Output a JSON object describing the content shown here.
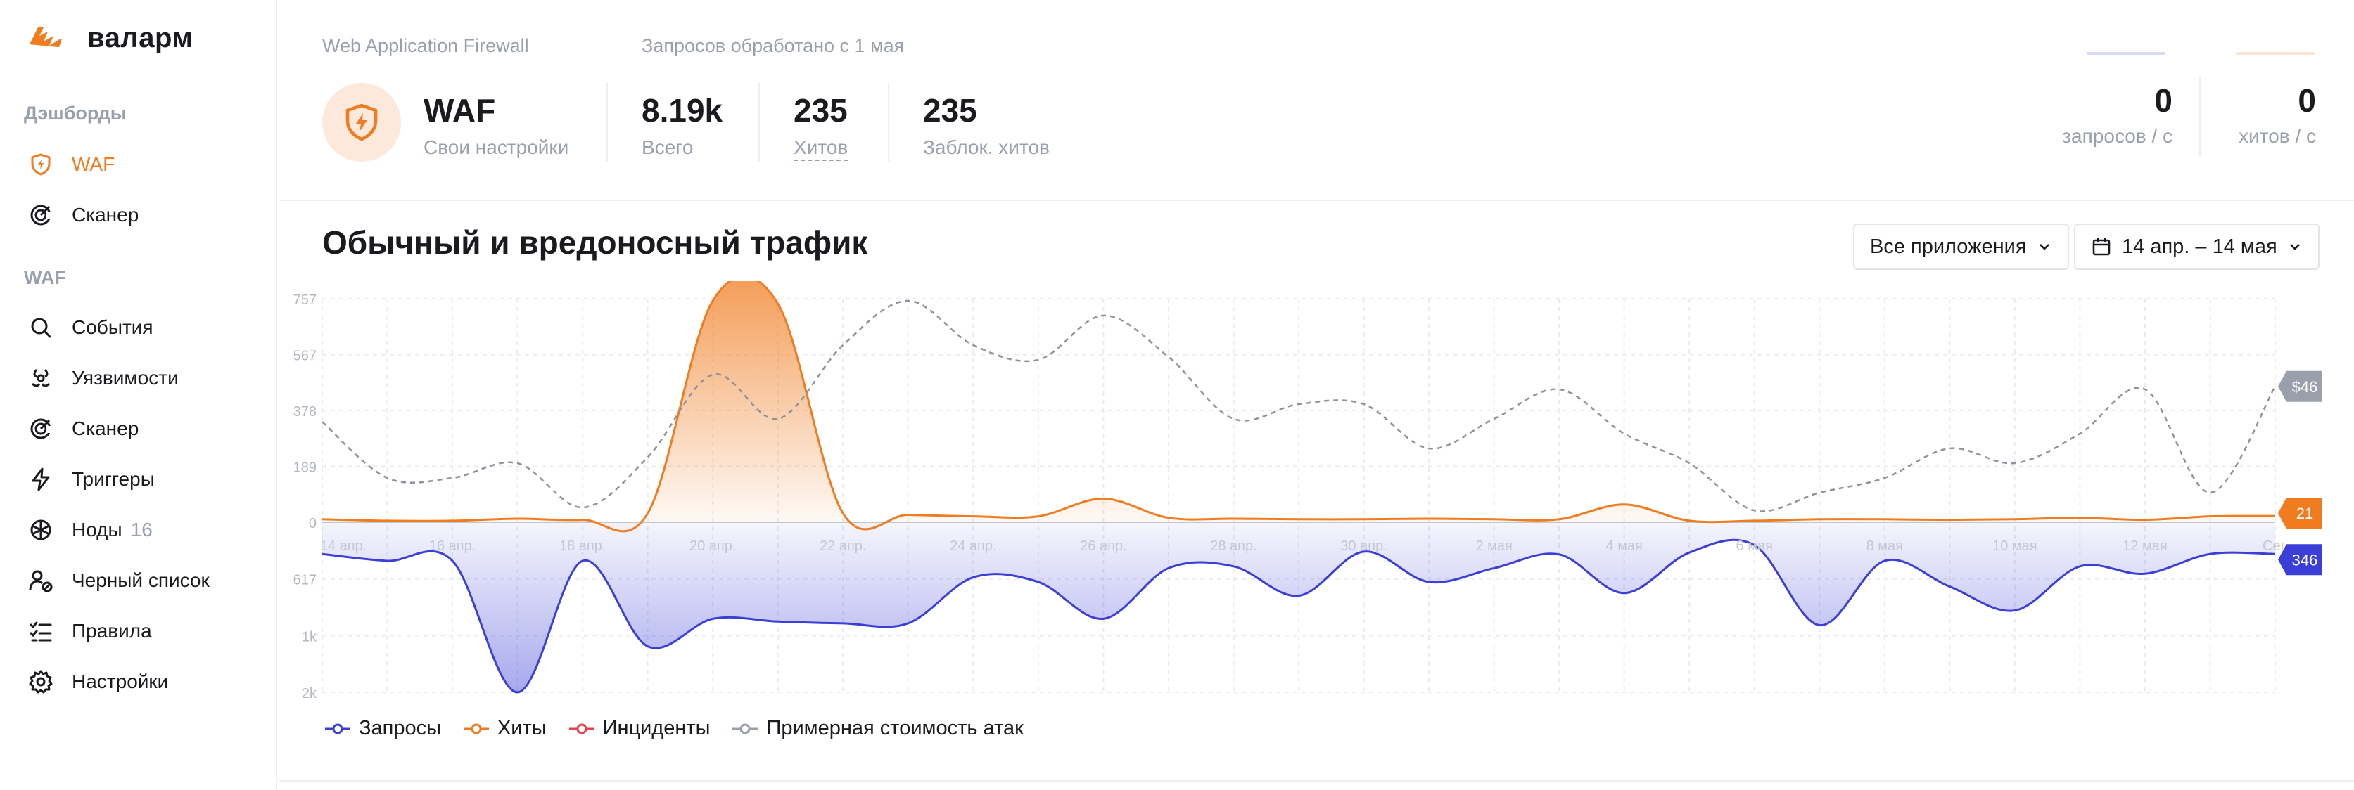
{
  "brand": {
    "name": "валарм"
  },
  "sidebar": {
    "sections": [
      {
        "title": "Дэшборды"
      },
      {
        "title": "WAF"
      }
    ],
    "items": [
      {
        "label": "WAF",
        "icon": "shield-icon",
        "active": true
      },
      {
        "label": "Сканер",
        "icon": "radar-icon"
      },
      {
        "label": "События",
        "icon": "search-icon"
      },
      {
        "label": "Уязвимости",
        "icon": "biohazard-icon"
      },
      {
        "label": "Сканер",
        "icon": "radar-icon"
      },
      {
        "label": "Триггеры",
        "icon": "lightning-icon"
      },
      {
        "label": "Ноды",
        "count": "16",
        "icon": "node-icon"
      },
      {
        "label": "Черный список",
        "icon": "blacklist-icon"
      },
      {
        "label": "Правила",
        "icon": "rules-icon"
      },
      {
        "label": "Настройки",
        "icon": "gear-icon"
      }
    ]
  },
  "header": {
    "product_label": "Web Application Firewall",
    "requests_label": "Запросов обработано с 1 мая",
    "waf_title": "WAF",
    "waf_subtitle": "Свои настройки",
    "total_value": "8.19k",
    "total_label": "Всего",
    "hits_value": "235",
    "hits_label": "Хитов",
    "blocked_value": "235",
    "blocked_label": "Заблок. хитов",
    "rate_requests_value": "0",
    "rate_requests_label": "запросов / с",
    "rate_hits_value": "0",
    "rate_hits_label": "хитов / с"
  },
  "main": {
    "title": "Обычный и вредоносный трафик",
    "apps_dropdown": "Все приложения",
    "date_range": "14 апр. – 14 мая"
  },
  "colors": {
    "accent": "#f07c1f",
    "requests": "#3b3fd8",
    "hits": "#f07c1f",
    "incidents": "#e8414b",
    "cost": "#9aa0ab"
  },
  "chart_data": {
    "type": "area",
    "x": [
      "14 апр.",
      "15 апр.",
      "16 апр.",
      "17 апр.",
      "18 апр.",
      "19 апр.",
      "20 апр.",
      "21 апр.",
      "22 апр.",
      "23 апр.",
      "24 апр.",
      "25 апр.",
      "26 апр.",
      "27 апр.",
      "28 апр.",
      "29 апр.",
      "30 апр.",
      "1 мая",
      "2 мая",
      "3 мая",
      "4 мая",
      "5 мая",
      "6 мая",
      "7 мая",
      "8 мая",
      "9 мая",
      "10 мая",
      "11 мая",
      "12 мая",
      "13 мая",
      "Сег."
    ],
    "x_tick_labels": [
      "14 апр.",
      "16 апр.",
      "18 апр.",
      "20 апр.",
      "22 апр.",
      "24 апр.",
      "26 апр.",
      "28 апр.",
      "30 апр.",
      "2 мая",
      "4 мая",
      "6 мая",
      "8 мая",
      "10 мая",
      "12 мая",
      "Сег."
    ],
    "upper_axis_ticks": [
      "757",
      "567",
      "378",
      "189",
      "0"
    ],
    "lower_axis_ticks": [
      "617",
      "1k",
      "2k"
    ],
    "ylim_upper": [
      0,
      757
    ],
    "ylim_lower": [
      0,
      1850
    ],
    "series": [
      {
        "name": "Хиты",
        "values": [
          10,
          5,
          5,
          12,
          8,
          30,
          750,
          740,
          30,
          25,
          20,
          20,
          80,
          15,
          12,
          10,
          10,
          12,
          10,
          10,
          60,
          5,
          5,
          10,
          10,
          8,
          10,
          15,
          8,
          20,
          21
        ]
      },
      {
        "name": "Примерная стоимость атак",
        "values": [
          340,
          150,
          150,
          200,
          50,
          220,
          500,
          350,
          600,
          750,
          600,
          550,
          700,
          560,
          350,
          400,
          400,
          250,
          350,
          450,
          300,
          200,
          40,
          100,
          150,
          250,
          200,
          300,
          450,
          100,
          460
        ]
      },
      {
        "name": "Запросы",
        "values": [
          346,
          420,
          420,
          1850,
          420,
          1350,
          1050,
          1080,
          1100,
          1100,
          600,
          650,
          1050,
          500,
          480,
          800,
          320,
          650,
          500,
          350,
          770,
          330,
          250,
          1120,
          420,
          700,
          960,
          480,
          560,
          346,
          346
        ]
      },
      {
        "name": "Инциденты",
        "values": []
      }
    ],
    "end_labels": {
      "cost": "$46",
      "hits": "21",
      "requests": "346"
    },
    "grid": true,
    "legend_position": "bottom-left"
  }
}
